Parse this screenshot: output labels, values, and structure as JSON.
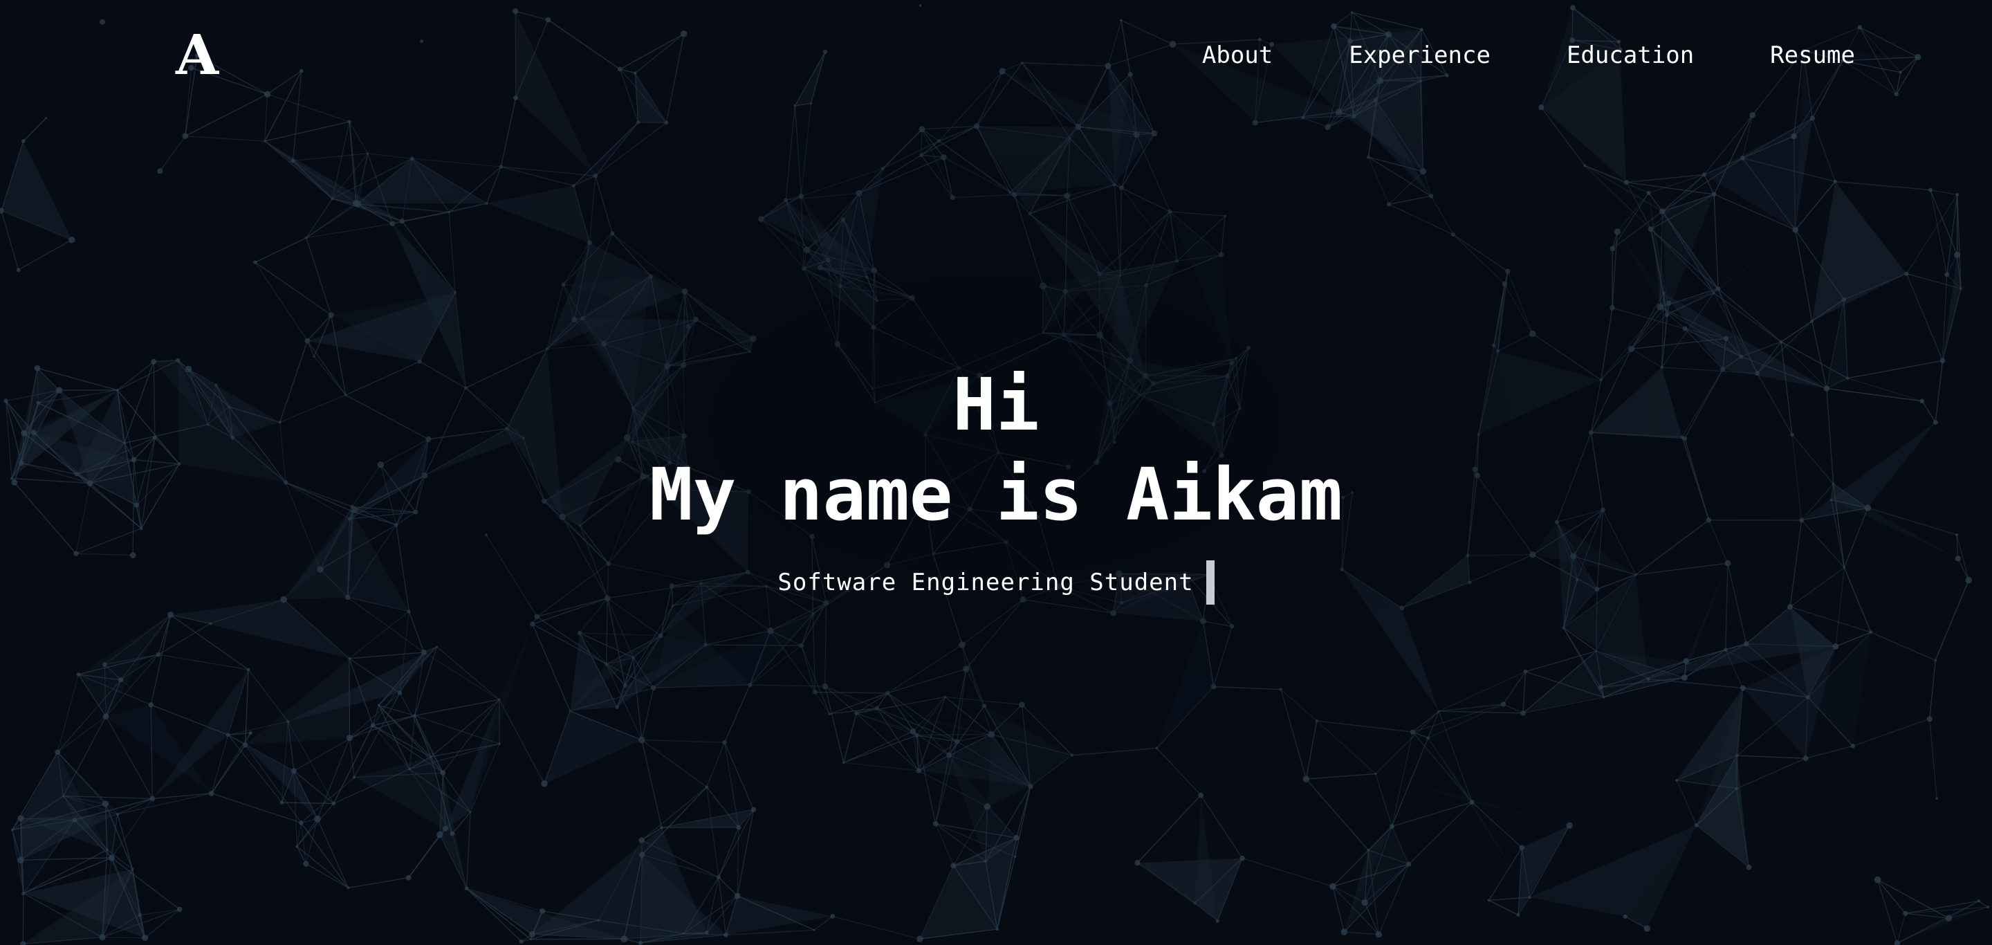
{
  "logo": {
    "text": "A"
  },
  "nav": {
    "items": [
      {
        "label": "About"
      },
      {
        "label": "Experience"
      },
      {
        "label": "Education"
      },
      {
        "label": "Resume"
      }
    ]
  },
  "hero": {
    "greeting": "Hi",
    "name_line": "My name is Aikam",
    "subtitle": "Software Engineering Student"
  },
  "colors": {
    "background": "#060b14",
    "network_lines": "#2a3a4a",
    "text": "#ffffff",
    "cursor": "#c9ccd2"
  },
  "icons": {
    "background": "particle-network-background"
  }
}
